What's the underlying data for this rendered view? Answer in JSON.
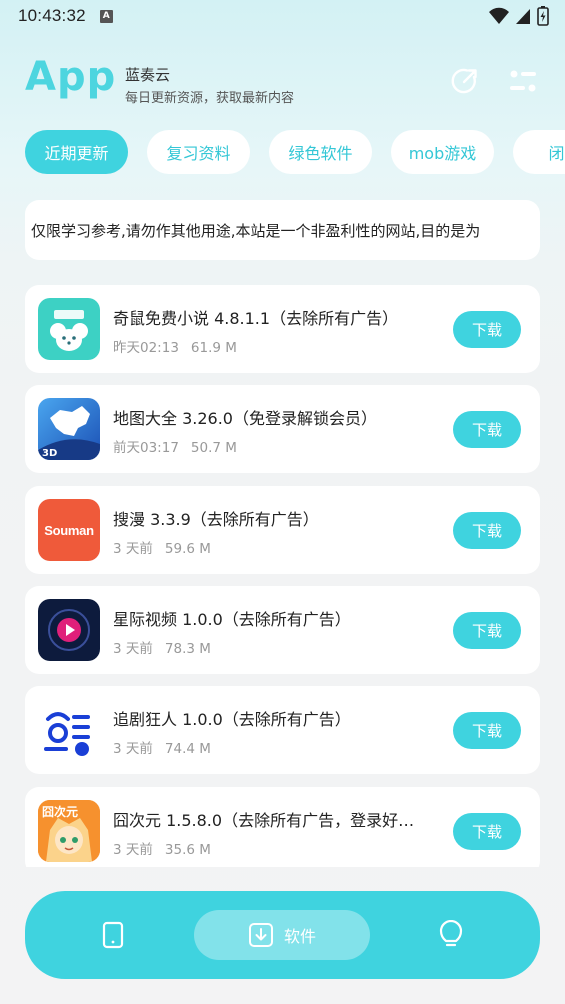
{
  "status_bar": {
    "time": "10:43:32",
    "notification_letter": "A"
  },
  "header": {
    "logo": "App",
    "title": "蓝奏云",
    "subtitle": "每日更新资源，获取最新内容"
  },
  "tabs": [
    {
      "label": "近期更新",
      "active": true
    },
    {
      "label": "复习资料",
      "active": false
    },
    {
      "label": "绿色软件",
      "active": false
    },
    {
      "label": "mob游戏",
      "active": false
    },
    {
      "label": "闭关",
      "active": false
    }
  ],
  "notice": {
    "text": "仅限学习参考,请勿作其他用途,本站是一个非盈利性的网站,目的是为"
  },
  "apps": [
    {
      "title": "奇鼠免费小说 4.8.1.1（去除所有广告）",
      "time": "昨天02:13",
      "size": "61.9 M",
      "icon": "qishu-icon",
      "download": "下载"
    },
    {
      "title": "地图大全 3.26.0（免登录解锁会员）",
      "time": "前天03:17",
      "size": "50.7 M",
      "icon": "map-icon",
      "download": "下载"
    },
    {
      "title": "搜漫 3.3.9（去除所有广告）",
      "time": "3 天前",
      "size": "59.6 M",
      "icon": "souman-icon",
      "icon_text": "Souman",
      "download": "下载"
    },
    {
      "title": "星际视频 1.0.0（去除所有广告）",
      "time": "3 天前",
      "size": "78.3 M",
      "icon": "xingji-icon",
      "download": "下载"
    },
    {
      "title": "追剧狂人 1.0.0（去除所有广告）",
      "time": "3 天前",
      "size": "74.4 M",
      "icon": "zhuiju-icon",
      "download": "下载"
    },
    {
      "title": "囧次元 1.5.8.0（去除所有广告，登录好…",
      "time": "3 天前",
      "size": "35.6 M",
      "icon": "jiongciyuan-icon",
      "icon_text": "囧次元",
      "download": "下载"
    }
  ],
  "bottom_nav": {
    "active_label": "软件"
  },
  "colors": {
    "accent": "#3fd3df",
    "logo": "#4dd5df",
    "tab_text": "#34c7d6"
  }
}
